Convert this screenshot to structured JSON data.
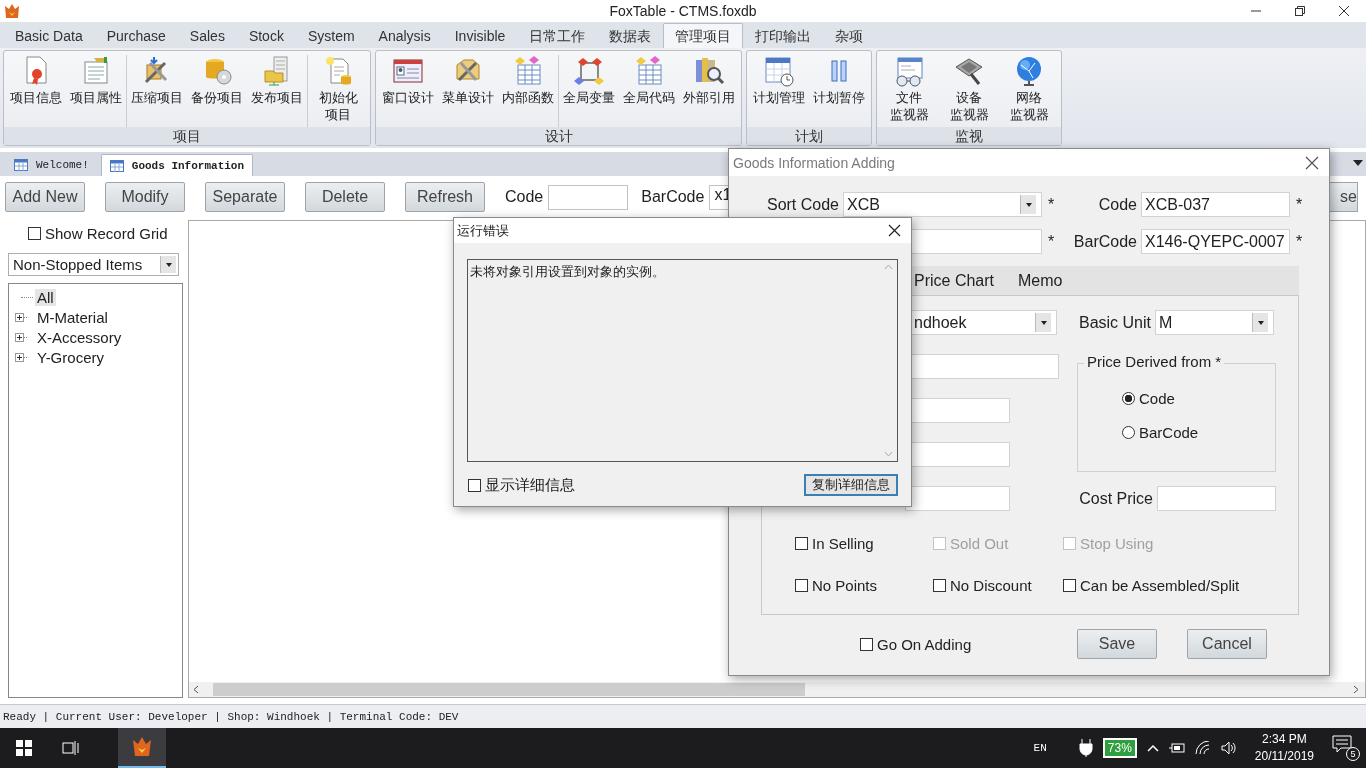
{
  "window": {
    "title": "FoxTable - CTMS.foxdb"
  },
  "menu_tabs": [
    {
      "label": "Basic Data",
      "selected": false
    },
    {
      "label": "Purchase",
      "selected": false
    },
    {
      "label": "Sales",
      "selected": false
    },
    {
      "label": "Stock",
      "selected": false
    },
    {
      "label": "System",
      "selected": false
    },
    {
      "label": "Analysis",
      "selected": false
    },
    {
      "label": "Invisible",
      "selected": false
    },
    {
      "label": "日常工作",
      "selected": false
    },
    {
      "label": "数据表",
      "selected": false
    },
    {
      "label": "管理项目",
      "selected": true
    },
    {
      "label": "打印输出",
      "selected": false
    },
    {
      "label": "杂项",
      "selected": false
    }
  ],
  "ribbon": {
    "groups": [
      {
        "title": "项目",
        "clusters": [
          [
            [
              "项目信息"
            ],
            [
              "项目属性"
            ]
          ],
          [
            [
              "压缩项目"
            ],
            [
              "备份项目"
            ],
            [
              "发布项目"
            ]
          ],
          [
            [
              "初始化",
              "项目"
            ]
          ]
        ]
      },
      {
        "title": "设计",
        "clusters": [
          [
            [
              "窗口设计"
            ],
            [
              "菜单设计"
            ],
            [
              "内部函数"
            ]
          ],
          [
            [
              "全局变量"
            ],
            [
              "全局代码"
            ],
            [
              "外部引用"
            ]
          ]
        ]
      },
      {
        "title": "计划",
        "clusters": [
          [
            [
              "计划管理"
            ],
            [
              "计划暂停"
            ]
          ]
        ]
      },
      {
        "title": "监视",
        "clusters": [
          [
            [
              "文件",
              "监视器"
            ],
            [
              "设备",
              "监视器"
            ],
            [
              "网络",
              "监视器"
            ]
          ]
        ]
      }
    ]
  },
  "document_tabs": [
    {
      "label": "Welcome!",
      "selected": false
    },
    {
      "label": "Goods Information",
      "selected": true
    }
  ],
  "toolbar": {
    "buttons": [
      "Add New",
      "Modify",
      "Separate",
      "Delete",
      "Refresh"
    ],
    "code_label": "Code",
    "barcode_label": "BarCode",
    "barcode_value": "x1",
    "partial_button": "se"
  },
  "sidebar": {
    "show_record_grid": {
      "label": "Show Record Grid",
      "checked": false
    },
    "filter": "Non-Stopped Items",
    "tree": [
      {
        "label": "All",
        "kind": "leaf",
        "selected": true
      },
      {
        "label": "M-Material",
        "kind": "folder",
        "expanded": false,
        "selected": false
      },
      {
        "label": "X-Accessory",
        "kind": "folder",
        "expanded": false,
        "selected": false
      },
      {
        "label": "Y-Grocery",
        "kind": "folder",
        "expanded": false,
        "selected": false
      }
    ]
  },
  "status_bar": "Ready | Current User: Developer | Shop: Windhoek | Terminal Code: DEV",
  "taskbar": {
    "language": "EN",
    "battery": "73%",
    "time": "2:34 PM",
    "date": "20/11/2019",
    "notifications": "5"
  },
  "goods_dialog": {
    "title": "Goods Information Adding",
    "sort_code": {
      "label": "Sort Code",
      "value": "XCB",
      "mark": "*"
    },
    "code": {
      "label": "Code",
      "value": "XCB-037",
      "mark": "*"
    },
    "name_mark": "*",
    "barcode": {
      "label": "BarCode",
      "value": "X146-QYEPC-0007",
      "mark": "*"
    },
    "tabs": [
      "Price Chart",
      "Memo"
    ],
    "shop_value": "ndhoek",
    "basic_unit": {
      "label": "Basic Unit",
      "value": "M"
    },
    "price_derived": {
      "title": "Price Derived from *",
      "options": [
        {
          "label": "Code",
          "selected": true
        },
        {
          "label": "BarCode",
          "selected": false
        }
      ]
    },
    "cost_price_label": "Cost Price",
    "checkboxes": [
      {
        "label": "In Selling",
        "checked": false,
        "disabled": false
      },
      {
        "label": "Sold Out",
        "checked": false,
        "disabled": true
      },
      {
        "label": "Stop Using",
        "checked": false,
        "disabled": true
      },
      {
        "label": "No Points",
        "checked": false,
        "disabled": false
      },
      {
        "label": "No Discount",
        "checked": false,
        "disabled": false
      },
      {
        "label": "Can be Assembled/Split",
        "checked": false,
        "disabled": false
      }
    ],
    "go_on_adding": {
      "label": "Go On Adding",
      "checked": false
    },
    "buttons": [
      "Save",
      "Cancel"
    ]
  },
  "error_dialog": {
    "title": "运行错误",
    "message": "未将对象引用设置到对象的实例。",
    "show_details": {
      "label": "显示详细信息",
      "checked": false
    },
    "copy_button": "复制详细信息"
  }
}
